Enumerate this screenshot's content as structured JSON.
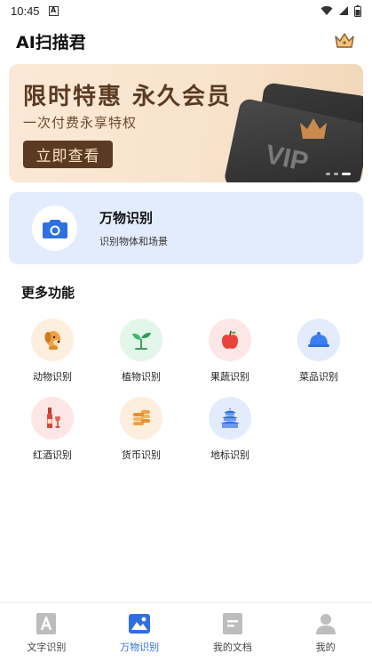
{
  "status_bar": {
    "time": "10:45",
    "indicator": "A"
  },
  "header": {
    "title": "AI扫描君"
  },
  "banner": {
    "title": "限时特惠 永久会员",
    "subtitle": "一次付费永享特权",
    "button_label": "立即查看",
    "card_text": "VIP"
  },
  "recognize": {
    "title": "万物识别",
    "subtitle": "识别物体和场景"
  },
  "more": {
    "title": "更多功能",
    "items": [
      {
        "label": "动物识别",
        "icon": "dog-icon",
        "bg": "#fdeede"
      },
      {
        "label": "植物识别",
        "icon": "sprout-icon",
        "bg": "#e3f6ea"
      },
      {
        "label": "果蔬识别",
        "icon": "apple-icon",
        "bg": "#fde6e6"
      },
      {
        "label": "菜品识别",
        "icon": "dish-cover-icon",
        "bg": "#e3ecfd"
      },
      {
        "label": "红酒识别",
        "icon": "wine-icon",
        "bg": "#fde6e6"
      },
      {
        "label": "货币识别",
        "icon": "coins-icon",
        "bg": "#fdeede"
      },
      {
        "label": "地标识别",
        "icon": "temple-icon",
        "bg": "#e3ecfd"
      }
    ]
  },
  "nav": {
    "items": [
      {
        "label": "文字识别",
        "icon": "text-doc-icon",
        "active": false
      },
      {
        "label": "万物识别",
        "icon": "image-icon",
        "active": true
      },
      {
        "label": "我的文档",
        "icon": "document-icon",
        "active": false
      },
      {
        "label": "我的",
        "icon": "person-icon",
        "active": false
      }
    ]
  },
  "colors": {
    "accent": "#2f6fe0",
    "banner_button": "#5b3a24",
    "card_bg": "#e3ecfd"
  }
}
